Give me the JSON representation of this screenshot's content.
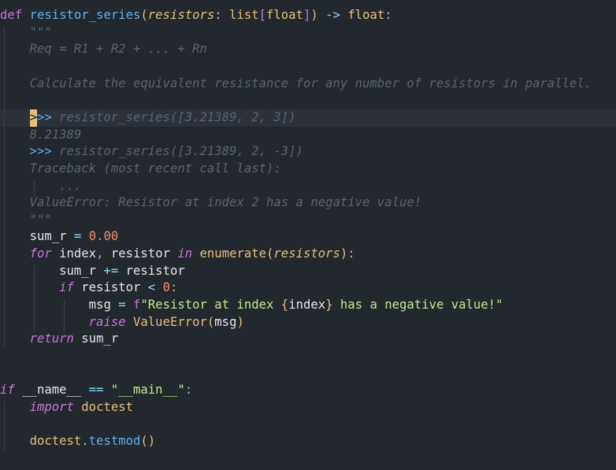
{
  "code_lines": [
    {
      "parts": [
        {
          "t": "def",
          "c": "kw"
        },
        {
          "t": " ",
          "c": "punc"
        },
        {
          "t": "resistor_series",
          "c": "fn"
        },
        {
          "t": "(",
          "c": "brk2"
        },
        {
          "t": "resistors",
          "c": "param"
        },
        {
          "t": ": ",
          "c": "punc"
        },
        {
          "t": "list",
          "c": "type"
        },
        {
          "t": "[",
          "c": "brk"
        },
        {
          "t": "float",
          "c": "type"
        },
        {
          "t": "]",
          "c": "brk"
        },
        {
          "t": ")",
          "c": "brk2"
        },
        {
          "t": " -> ",
          "c": "op"
        },
        {
          "t": "float",
          "c": "type"
        },
        {
          "t": ":",
          "c": "punc"
        }
      ]
    },
    {
      "parts": [
        {
          "t": "    ",
          "c": "punc"
        },
        {
          "t": "\"\"\"",
          "c": "cmt"
        }
      ]
    },
    {
      "parts": [
        {
          "t": "    ",
          "c": "punc"
        },
        {
          "t": "Req = R1 + R2 + ... + Rn",
          "c": "cmt"
        }
      ]
    },
    {
      "parts": [
        {
          "t": "",
          "c": "punc"
        }
      ]
    },
    {
      "parts": [
        {
          "t": "    ",
          "c": "punc"
        },
        {
          "t": "Calculate the equivalent resistance for any number of resistors in parallel.",
          "c": "cmt"
        }
      ]
    },
    {
      "parts": [
        {
          "t": "",
          "c": "punc"
        }
      ]
    },
    {
      "current": true,
      "parts": [
        {
          "t": "    ",
          "c": "punc"
        },
        {
          "t": ">",
          "c": "caret-block"
        },
        {
          "t": ">> ",
          "c": "prompt"
        },
        {
          "t": "resistor_series([3.21389, 2, 3])",
          "c": "cmt"
        }
      ]
    },
    {
      "parts": [
        {
          "t": "    ",
          "c": "punc"
        },
        {
          "t": "8.21389",
          "c": "cmt"
        }
      ]
    },
    {
      "parts": [
        {
          "t": "    ",
          "c": "punc"
        },
        {
          "t": ">>> ",
          "c": "prompt"
        },
        {
          "t": "resistor_series([3.21389, 2, -3])",
          "c": "cmt"
        }
      ]
    },
    {
      "parts": [
        {
          "t": "    ",
          "c": "punc"
        },
        {
          "t": "Traceback (most recent call last):",
          "c": "cmt"
        }
      ]
    },
    {
      "parts": [
        {
          "t": "        ",
          "c": "punc"
        },
        {
          "t": "...",
          "c": "cmt"
        }
      ]
    },
    {
      "parts": [
        {
          "t": "    ",
          "c": "punc"
        },
        {
          "t": "ValueError: Resistor at index 2 has a negative value!",
          "c": "cmt"
        }
      ]
    },
    {
      "parts": [
        {
          "t": "    ",
          "c": "punc"
        },
        {
          "t": "\"\"\"",
          "c": "cmt"
        }
      ]
    },
    {
      "parts": [
        {
          "t": "    ",
          "c": "punc"
        },
        {
          "t": "sum_r",
          "c": "var"
        },
        {
          "t": " = ",
          "c": "op"
        },
        {
          "t": "0.00",
          "c": "num"
        }
      ]
    },
    {
      "parts": [
        {
          "t": "    ",
          "c": "punc"
        },
        {
          "t": "for",
          "c": "kwi"
        },
        {
          "t": " ",
          "c": "punc"
        },
        {
          "t": "index",
          "c": "var"
        },
        {
          "t": ", ",
          "c": "punc"
        },
        {
          "t": "resistor",
          "c": "var"
        },
        {
          "t": " ",
          "c": "punc"
        },
        {
          "t": "in",
          "c": "kwi"
        },
        {
          "t": " ",
          "c": "punc"
        },
        {
          "t": "enumerate",
          "c": "cls"
        },
        {
          "t": "(",
          "c": "brk2"
        },
        {
          "t": "resistors",
          "c": "param"
        },
        {
          "t": ")",
          "c": "brk2"
        },
        {
          "t": ":",
          "c": "punc"
        }
      ]
    },
    {
      "parts": [
        {
          "t": "        ",
          "c": "punc"
        },
        {
          "t": "sum_r",
          "c": "var"
        },
        {
          "t": " += ",
          "c": "op"
        },
        {
          "t": "resistor",
          "c": "var"
        }
      ]
    },
    {
      "parts": [
        {
          "t": "        ",
          "c": "punc"
        },
        {
          "t": "if",
          "c": "kwi"
        },
        {
          "t": " ",
          "c": "punc"
        },
        {
          "t": "resistor",
          "c": "var"
        },
        {
          "t": " < ",
          "c": "op"
        },
        {
          "t": "0",
          "c": "num"
        },
        {
          "t": ":",
          "c": "punc"
        }
      ]
    },
    {
      "parts": [
        {
          "t": "            ",
          "c": "punc"
        },
        {
          "t": "msg",
          "c": "var"
        },
        {
          "t": " = ",
          "c": "op"
        },
        {
          "t": "f",
          "c": "kw"
        },
        {
          "t": "\"Resistor at index ",
          "c": "str"
        },
        {
          "t": "{",
          "c": "brk2"
        },
        {
          "t": "index",
          "c": "var"
        },
        {
          "t": "}",
          "c": "brk2"
        },
        {
          "t": " has a negative value!\"",
          "c": "str"
        }
      ]
    },
    {
      "parts": [
        {
          "t": "            ",
          "c": "punc"
        },
        {
          "t": "raise",
          "c": "kwi"
        },
        {
          "t": " ",
          "c": "punc"
        },
        {
          "t": "ValueError",
          "c": "cls"
        },
        {
          "t": "(",
          "c": "brk2"
        },
        {
          "t": "msg",
          "c": "var"
        },
        {
          "t": ")",
          "c": "brk2"
        }
      ]
    },
    {
      "parts": [
        {
          "t": "    ",
          "c": "punc"
        },
        {
          "t": "return",
          "c": "kwi"
        },
        {
          "t": " ",
          "c": "punc"
        },
        {
          "t": "sum_r",
          "c": "var"
        }
      ]
    },
    {
      "parts": [
        {
          "t": "",
          "c": "punc"
        }
      ]
    },
    {
      "parts": [
        {
          "t": "",
          "c": "punc"
        }
      ]
    },
    {
      "parts": [
        {
          "t": "if",
          "c": "kwi"
        },
        {
          "t": " ",
          "c": "punc"
        },
        {
          "t": "__name__",
          "c": "var"
        },
        {
          "t": " == ",
          "c": "op"
        },
        {
          "t": "\"__main__\"",
          "c": "str"
        },
        {
          "t": ":",
          "c": "punc"
        }
      ]
    },
    {
      "parts": [
        {
          "t": "    ",
          "c": "punc"
        },
        {
          "t": "import",
          "c": "kwi"
        },
        {
          "t": " ",
          "c": "punc"
        },
        {
          "t": "doctest",
          "c": "cls"
        }
      ]
    },
    {
      "parts": [
        {
          "t": "",
          "c": "punc"
        }
      ]
    },
    {
      "parts": [
        {
          "t": "    ",
          "c": "punc"
        },
        {
          "t": "doctest",
          "c": "cls"
        },
        {
          "t": ".",
          "c": "punc"
        },
        {
          "t": "testmod",
          "c": "fn"
        },
        {
          "t": "()",
          "c": "brk2"
        }
      ]
    }
  ]
}
